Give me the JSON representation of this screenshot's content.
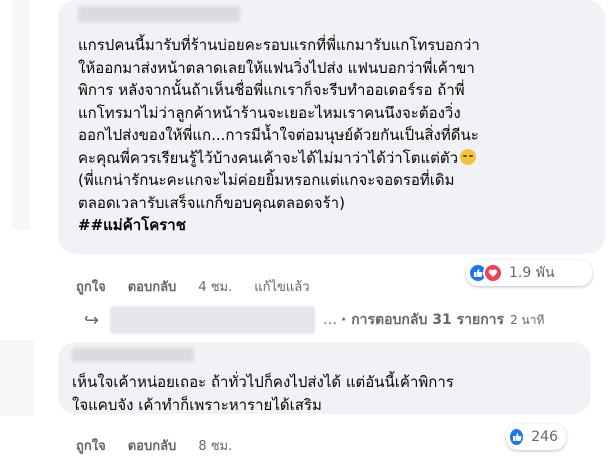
{
  "comments": [
    {
      "lines": [
        "แกรปคนนี้มารับที่ร้านบ่อยคะรอบแรกที่พี่แกมารับแกโทรบอกว่า",
        "ให้ออกมาส่งหน้าตลาดเลยให้แฟนวิ่งไปส่ง แฟนบอกว่าพี่เค้าขา",
        "พิการ หลังจากนั้นถ้าเห็นชื่อพี่แกเราก็จะรีบทำออเดอร์รอ ถ้าพี่",
        "แกโทรมาไม่ว่าลูกค้าหน้าร้านจะเยอะไหมเราคนนึงจะต้องวิ่ง",
        "ออกไปส่งของให้พี่แก...การมีน้ำใจต่อมนุษย์ด้วยกันเป็นสิ่งที่ดีนะ",
        "คะคุณพี่ควรเรียนรู้ไว้บ้างคนเค้าจะได้ไม่มาว่าได้ว่าโตแต่ตัว",
        "(พี่แกน่ารักนะคะแกจะไม่ค่อยยิ้มหรอกแต่แกจะจอดรอที่เดิม",
        "ตลอดเวลารับเสร็จแกก็ขอบคุณตลอดจร้า)"
      ],
      "hashtag": "##แม่ค้าโคราช",
      "reaction_count": "1.9 พัน",
      "like": "ถูกใจ",
      "reply": "ตอบกลับ",
      "time": "4 ชม.",
      "edited": "แก้ไขแล้ว"
    },
    {
      "lines": [
        "เห็นใจเค้าหน่อยเถอะ ถ้าทั่วไปก็คงไปส่งได้ แต่อันนี้เค้าพิการ",
        "ใจแคบจัง เค้าทำก็เพราะหารายได้เสริม"
      ],
      "reaction_count": "246",
      "like": "ถูกใจ",
      "reply": "ตอบกลับ",
      "time": "8 ชม."
    }
  ],
  "replies_row": {
    "arrow": "↪",
    "ellipsis": "…",
    "link": "· การตอบกลับ 31 รายการ",
    "time": "2 นาที"
  },
  "icons": [
    "like-icon",
    "love-icon",
    "reply-arrow-icon",
    "emoji-icon"
  ],
  "colors": {
    "bubble": "#f0f2f5",
    "muted_text": "#65676b",
    "like_blue": "#1877f2",
    "love_red": "#f33e58"
  }
}
